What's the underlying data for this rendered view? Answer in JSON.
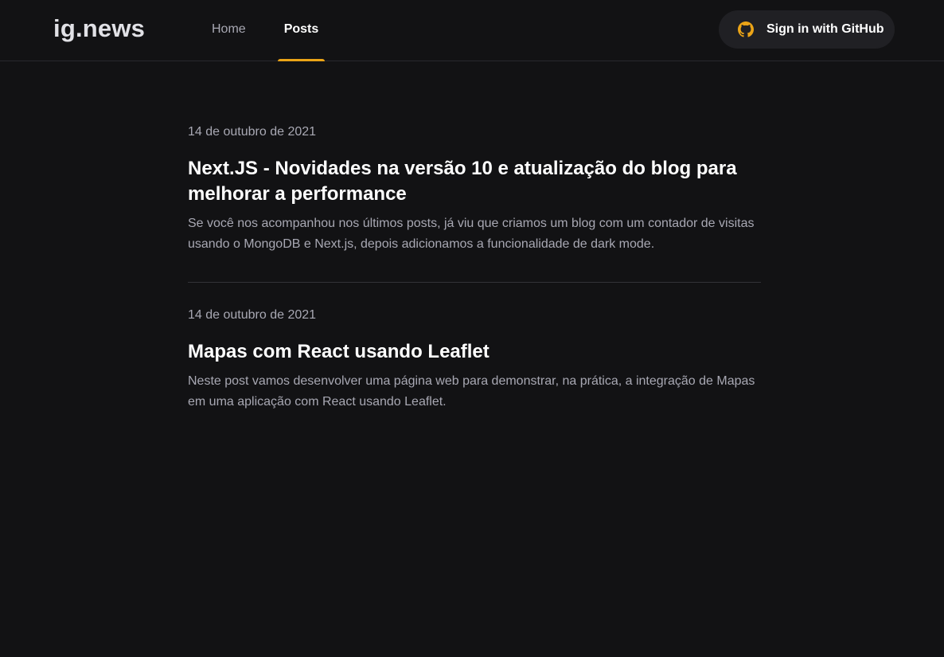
{
  "header": {
    "logo": "ig.news",
    "nav": [
      {
        "label": "Home",
        "active": false
      },
      {
        "label": "Posts",
        "active": true
      }
    ],
    "signin_label": "Sign in with GitHub",
    "signin_icon": "github-icon",
    "accent_color": "#eba417"
  },
  "posts": [
    {
      "date": "14 de outubro de 2021",
      "title": "Next.JS - Novidades na versão 10 e atualização do blog para melhorar a performance",
      "excerpt": "Se você nos acompanhou nos últimos posts, já viu que criamos um blog com um contador de visitas usando o MongoDB e Next.js, depois adicionamos a funcionalidade de dark mode."
    },
    {
      "date": "14 de outubro de 2021",
      "title": "Mapas com React usando Leaflet",
      "excerpt": "Neste post vamos desenvolver uma página web para demonstrar, na prática, a integração de Mapas em uma aplicação com React usando Leaflet."
    }
  ]
}
